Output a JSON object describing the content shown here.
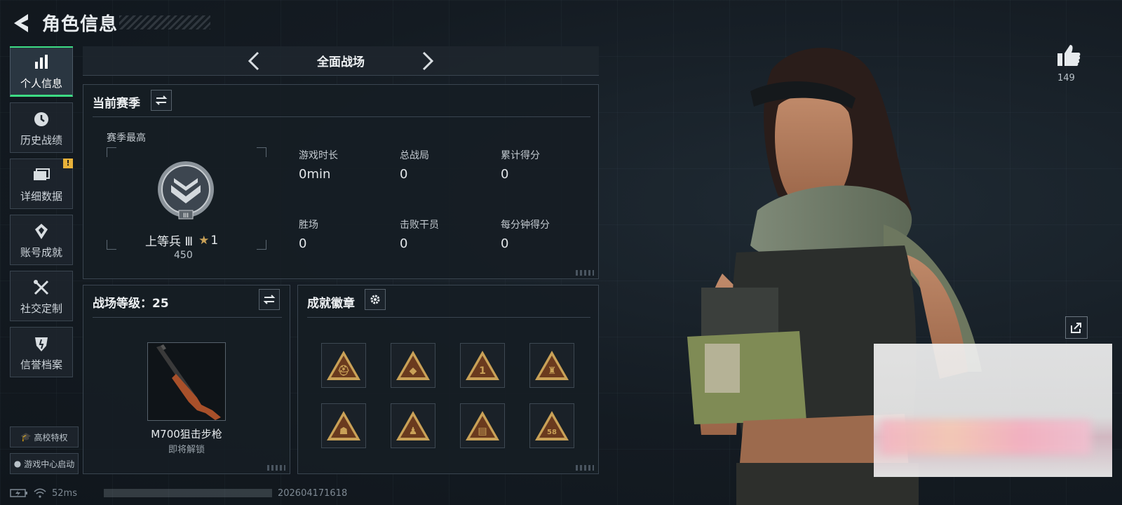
{
  "header": {
    "title": "角色信息"
  },
  "sidebar": {
    "items": [
      {
        "label": "个人信息",
        "active": true
      },
      {
        "label": "历史战绩"
      },
      {
        "label": "详细数据",
        "alert": "!"
      },
      {
        "label": "账号成就"
      },
      {
        "label": "社交定制"
      },
      {
        "label": "信誉档案"
      }
    ],
    "bottom_buttons": [
      "高校特权",
      "游戏中心启动"
    ]
  },
  "mode_bar": {
    "title": "全面战场"
  },
  "season_panel": {
    "title": "当前赛季",
    "best_label": "赛季最高",
    "rank_name": "上等兵 Ⅲ",
    "rank_stars": "1",
    "rank_points": "450",
    "stats": [
      {
        "label": "游戏时长",
        "value": "0min"
      },
      {
        "label": "总战局",
        "value": "0"
      },
      {
        "label": "累计得分",
        "value": "0"
      },
      {
        "label": "胜场",
        "value": "0"
      },
      {
        "label": "击败干员",
        "value": "0"
      },
      {
        "label": "每分钟得分",
        "value": "0"
      }
    ]
  },
  "level_panel": {
    "title": "战场等级：25",
    "weapon_name": "M700狙击步枪",
    "weapon_status": "即将解锁"
  },
  "badge_panel": {
    "title": "成就徽章",
    "badge_icons": [
      "badge-helmet-icon",
      "badge-diamond-icon",
      "badge-number-one-icon",
      "badge-tower-icon",
      "badge-soldiers-icon",
      "badge-figure-icon",
      "badge-document-icon",
      "badge-58-icon"
    ]
  },
  "right": {
    "like_count": "149"
  },
  "status_bar": {
    "ping": "52ms",
    "build": "202604171618"
  },
  "colors": {
    "accent": "#3ddc84",
    "badge_gold": "#c9a157",
    "badge_brown": "#6a3a1e",
    "alert": "#e8b23a"
  }
}
